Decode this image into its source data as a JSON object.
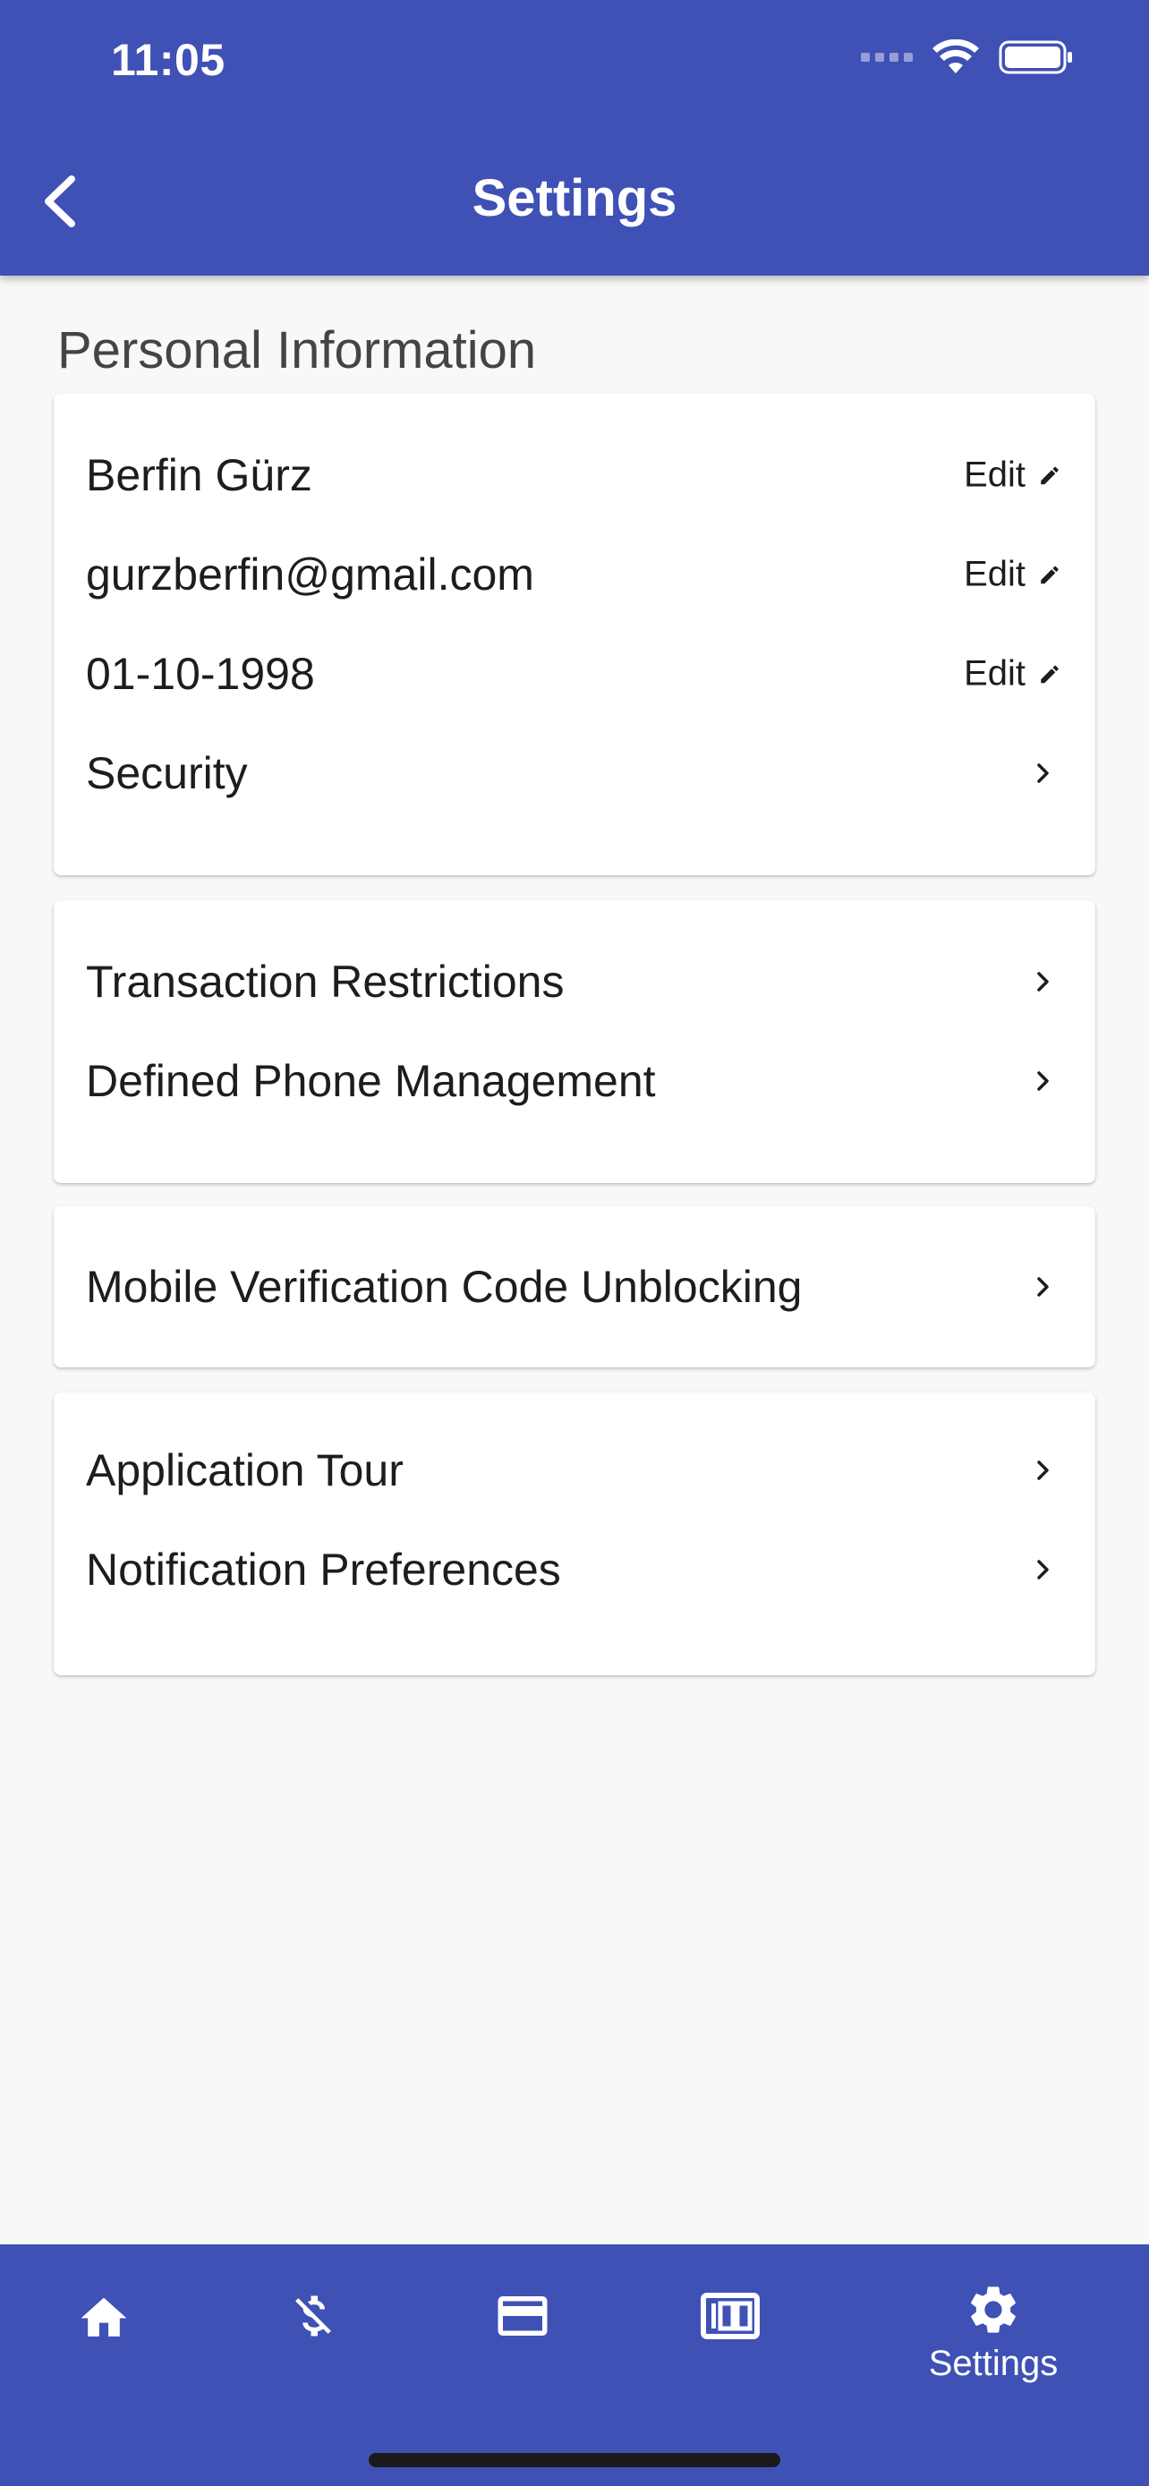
{
  "status_bar": {
    "time": "11:05"
  },
  "app_bar": {
    "title": "Settings"
  },
  "personal_section": {
    "title": "Personal Information",
    "rows": [
      {
        "label": "Berfin Gürz",
        "action": "Edit"
      },
      {
        "label": "gurzberfin@gmail.com",
        "action": "Edit"
      },
      {
        "label": "01-10-1998",
        "action": "Edit"
      },
      {
        "label": "Security"
      }
    ]
  },
  "card2": {
    "rows": [
      {
        "label": "Transaction Restrictions"
      },
      {
        "label": "Defined Phone Management"
      }
    ]
  },
  "card3": {
    "rows": [
      {
        "label": "Mobile Verification Code Unblocking"
      }
    ]
  },
  "card4": {
    "rows": [
      {
        "label": "Application Tour"
      },
      {
        "label": "Notification Preferences"
      }
    ]
  },
  "bottom_nav": {
    "items": [
      {
        "icon": "home-icon"
      },
      {
        "icon": "money-off-icon"
      },
      {
        "icon": "credit-card-icon"
      },
      {
        "icon": "counter-icon"
      },
      {
        "icon": "gear-icon",
        "label": "Settings",
        "active": true
      }
    ]
  },
  "colors": {
    "primary": "#3f51b5",
    "background": "#f8f8f8",
    "card": "#ffffff"
  }
}
